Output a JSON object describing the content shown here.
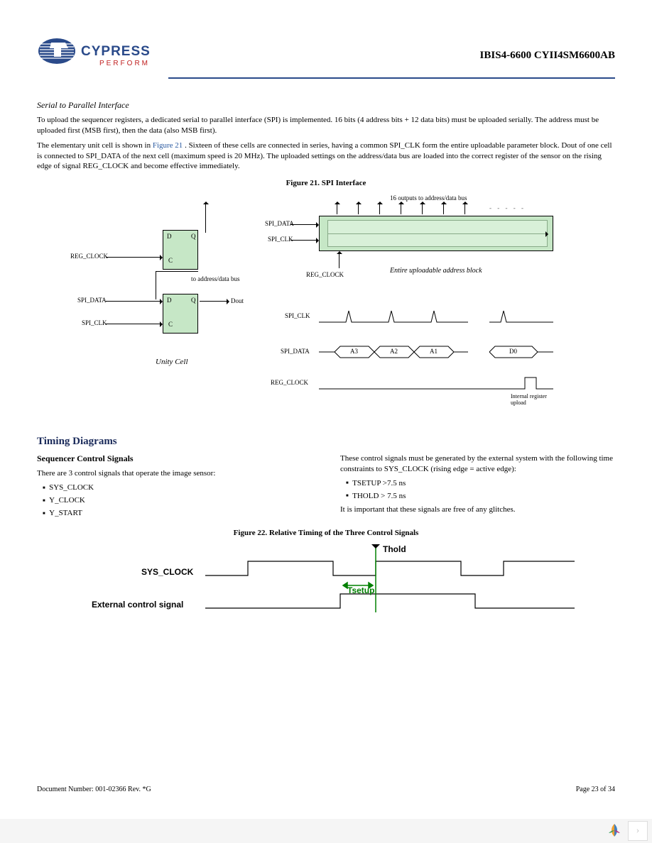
{
  "header": {
    "brand_name": "CYPRESS",
    "brand_tagline": "PERFORM",
    "doc_title": "IBIS4-6600 CYII4SM6600AB"
  },
  "section1": {
    "title": "Serial to Parallel Interface",
    "p1": "To upload the sequencer registers, a dedicated serial to parallel interface (SPI) is implemented. 16 bits (4 address bits + 12 data bits) must be uploaded serially. The address must be uploaded first (MSB first), then the data (also MSB first).",
    "p2_a": "The elementary unit cell is shown in ",
    "p2_link": "Figure 21",
    "p2_b": ". Sixteen of these cells are connected in series, having a common SPI_CLK form the entire uploadable parameter block. Dout of one cell is connected to SPI_DATA of the next cell (maximum speed is 20 MHz). The uploaded settings on the address/data bus are loaded into the correct register of the sensor on the rising edge of signal REG_CLOCK and become effective immediately."
  },
  "figure21": {
    "caption": "Figure 21.  SPI Interface",
    "labels": {
      "reg_clock": "REG_CLOCK",
      "spi_data": "SPI_DATA",
      "spi_clk": "SPI_CLK",
      "to_bus": "to address/data bus",
      "dout": "Dout",
      "unity_cell": "Unity Cell",
      "d": "D",
      "q": "Q",
      "c": "C",
      "outputs_bus": "16 outputs to address/data bus",
      "entire_block": "Entire uploadable address block",
      "a3": "A3",
      "a2": "A2",
      "a1": "A1",
      "d0": "D0",
      "internal_upload": "Internal register upload"
    }
  },
  "section2": {
    "h2": "Timing Diagrams",
    "h3": "Sequencer Control Signals",
    "intro": "There are 3 control signals that operate the image sensor:",
    "signals": [
      "SYS_CLOCK",
      "Y_CLOCK",
      "Y_START"
    ],
    "right_intro": "These control signals must be generated by the external system with the following time constraints to SYS_CLOCK (rising edge = active edge):",
    "constraints": [
      "TSETUP >7.5 ns",
      "THOLD > 7.5 ns"
    ],
    "right_note": "It is important that these signals are free of any glitches."
  },
  "figure22": {
    "caption": "Figure 22.  Relative Timing of the Three Control Signals",
    "sys_clock": "SYS_CLOCK",
    "ext_signal": "External control signal",
    "thold": "Thold",
    "tsetup": "Tsetup"
  },
  "footer": {
    "left": "Document Number: 001-02366  Rev. *G",
    "right": "Page 23 of 34"
  }
}
